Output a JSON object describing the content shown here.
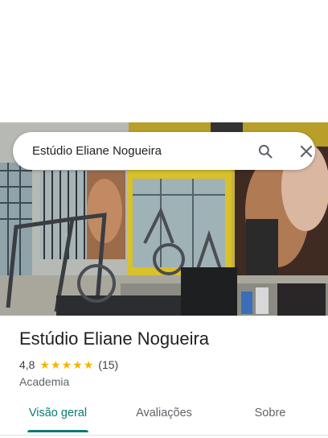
{
  "search": {
    "query": "Estúdio Eliane Nogueira"
  },
  "place": {
    "title": "Estúdio Eliane Nogueira",
    "rating": "4,8",
    "rating_out_of_5": 4.8,
    "review_count": "(15)",
    "category": "Academia"
  },
  "tabs": [
    {
      "label": "Visão geral",
      "active": true
    },
    {
      "label": "Avaliações",
      "active": false
    },
    {
      "label": "Sobre",
      "active": false
    }
  ],
  "colors": {
    "accent": "#0b7a75",
    "star": "#f4b400",
    "wall_yellow": "#d8c12a"
  },
  "icons": {
    "search": "search-icon",
    "close": "close-icon",
    "star": "star-icon"
  }
}
